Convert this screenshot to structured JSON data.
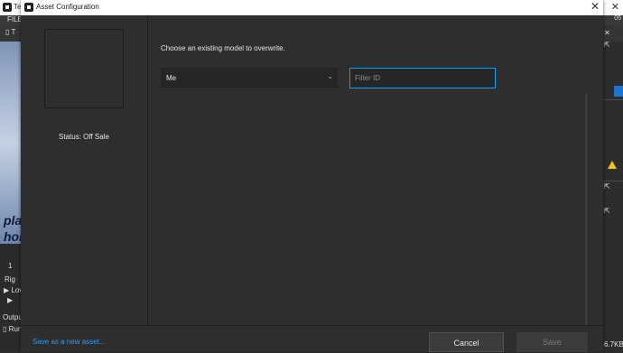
{
  "background": {
    "title_fragment": "Te",
    "menu_file": "FILE",
    "menu_right": "05",
    "tab_fragment": "T",
    "viewport_lines": [
      "pla",
      "hol"
    ],
    "panel_lines": [
      "1",
      "Rig",
      "Lov",
      "",
      "Outpu",
      "Run"
    ],
    "right_size_label": "6.7KB"
  },
  "dialog": {
    "title": "Asset Configuration",
    "status": "Status: Off Sale",
    "instruction": "Choose an existing model to overwrite.",
    "owner_select": {
      "value": "Me"
    },
    "filter": {
      "placeholder": "Filter ID",
      "value": ""
    },
    "footer": {
      "save_new_link": "Save as a new asset...",
      "cancel": "Cancel",
      "save": "Save"
    }
  },
  "colors": {
    "accent": "#00a2ff",
    "link": "#2e9bf0",
    "panel": "#2e2e2e",
    "warning": "#f2c318"
  }
}
